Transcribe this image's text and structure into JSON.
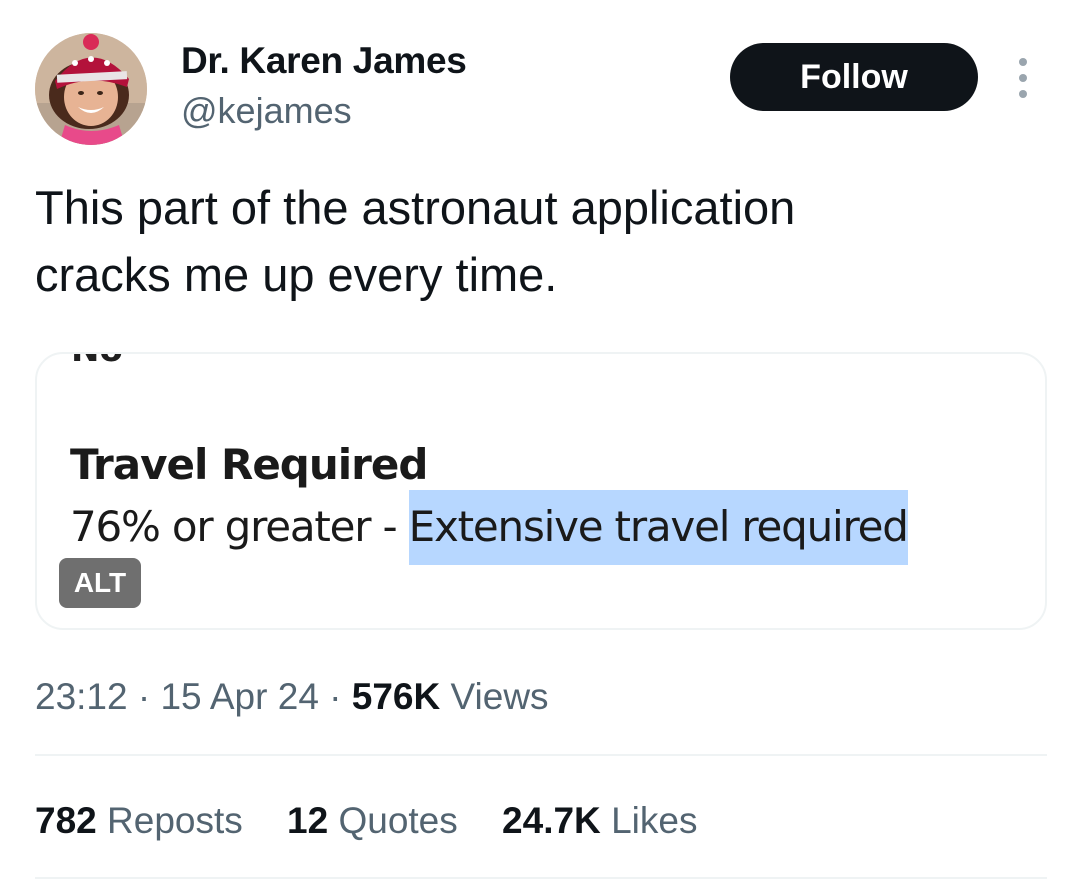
{
  "author": {
    "name": "Dr. Karen James",
    "handle": "@kejames",
    "follow_label": "Follow"
  },
  "tweet": {
    "text_line1": "This part of the astronaut application",
    "text_line2": "cracks me up every time."
  },
  "media": {
    "cut_text": "No",
    "heading": "Travel Required",
    "line_prefix": "76% or greater - ",
    "line_highlight": "Extensive travel required",
    "alt_label": "ALT",
    "highlight_color": "#b7d7ff"
  },
  "meta": {
    "time": "23:12",
    "date": "15 Apr 24",
    "views_count": "576K",
    "views_label": "Views",
    "separator": "·"
  },
  "stats": {
    "reposts_count": "782",
    "reposts_label": "Reposts",
    "quotes_count": "12",
    "quotes_label": "Quotes",
    "likes_count": "24.7K",
    "likes_label": "Likes"
  },
  "icons": {
    "avatar": "profile-photo",
    "more": "more-options-icon"
  },
  "colors": {
    "text": "#0f1419",
    "secondary": "#536471",
    "button_bg": "#0f1419",
    "border": "#eff3f4"
  }
}
